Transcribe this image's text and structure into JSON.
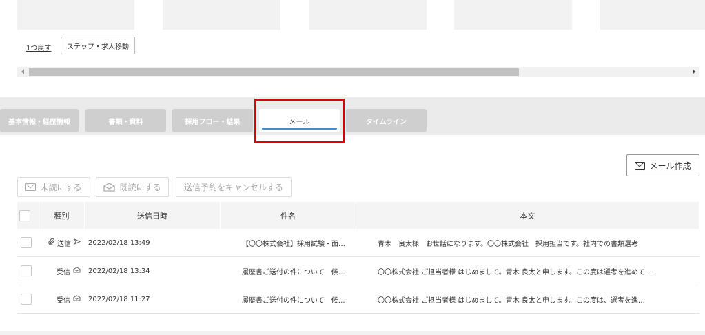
{
  "nav": {
    "back_label": "1つ戻す",
    "move_label": "ステップ・求人移動"
  },
  "tabs": [
    {
      "label": "基本情報・経歴情報",
      "active": false
    },
    {
      "label": "書類・資料",
      "active": false
    },
    {
      "label": "採用フロー・結果",
      "active": false
    },
    {
      "label": "メール",
      "active": true
    },
    {
      "label": "タイムライン",
      "active": false
    }
  ],
  "compose": {
    "label": "メール作成",
    "icon": "mail-icon"
  },
  "actions": {
    "mark_unread": "未読にする",
    "mark_read": "既読にする",
    "cancel_scheduled": "送信予約をキャンセルする"
  },
  "table": {
    "headers": {
      "type": "種別",
      "date": "送信日時",
      "subject": "件名",
      "body": "本文"
    },
    "rows": [
      {
        "attachment": true,
        "type": "送信",
        "direction": "send",
        "date": "2022/02/18 13:49",
        "subject": "【〇〇株式会社】採用試験・面…",
        "body": "青木　良太様　お世話になります。〇〇株式会社　採用担当です。社内での書類選考"
      },
      {
        "attachment": false,
        "type": "受信",
        "direction": "receive",
        "date": "2022/02/18 13:34",
        "subject": "履歴書ご送付の件について　候…",
        "body": "〇〇株式会社 ご担当者様 はじめまして。青木 良太と申します。この度は選考を進めて…"
      },
      {
        "attachment": false,
        "type": "受信",
        "direction": "receive",
        "date": "2022/02/18 11:27",
        "subject": "履歴書ご送付の件について　候…",
        "body": "〇〇株式会社 ご担当者様 はじめまして。青木 良太と申します。この度は、選考を進…"
      }
    ]
  },
  "colors": {
    "active_tab_underline": "#3d8fd4",
    "highlight": "#e00000",
    "tab_inactive": "#cfcfcf"
  }
}
